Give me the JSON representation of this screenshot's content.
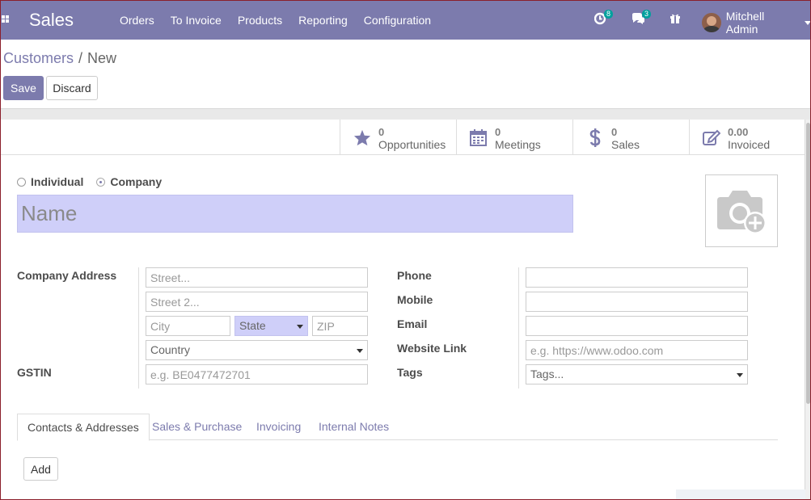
{
  "navbar": {
    "app_name": "Sales",
    "menu": [
      "Orders",
      "To Invoice",
      "Products",
      "Reporting",
      "Configuration"
    ],
    "activity_count": "8",
    "messages_count": "3",
    "user_name": "Mitchell Admin",
    "bg_color": "#7c7bad"
  },
  "breadcrumb": {
    "parent": "Customers",
    "separator": "/",
    "current": "New"
  },
  "actions": {
    "save": "Save",
    "discard": "Discard"
  },
  "smart_buttons": [
    {
      "icon": "star-icon",
      "value": "0",
      "label": "Opportunities"
    },
    {
      "icon": "calendar-icon",
      "value": "0",
      "label": "Meetings"
    },
    {
      "icon": "dollar-icon",
      "value": "0",
      "label": "Sales"
    },
    {
      "icon": "edit-icon",
      "value": "0.00",
      "label": "Invoiced"
    }
  ],
  "company_type": {
    "individual": "Individual",
    "company": "Company",
    "selected": "Company"
  },
  "name": {
    "placeholder": "Name"
  },
  "address": {
    "label": "Company Address",
    "street_placeholder": "Street...",
    "street2_placeholder": "Street 2...",
    "city_placeholder": "City",
    "state_placeholder": "State",
    "zip_placeholder": "ZIP",
    "country_placeholder": "Country"
  },
  "gstin": {
    "label": "GSTIN",
    "placeholder": "e.g. BE0477472701"
  },
  "contact": {
    "phone_label": "Phone",
    "mobile_label": "Mobile",
    "email_label": "Email",
    "website_label": "Website Link",
    "website_placeholder": "e.g. https://www.odoo.com",
    "tags_label": "Tags",
    "tags_placeholder": "Tags..."
  },
  "tabs": [
    "Contacts & Addresses",
    "Sales & Purchase",
    "Invoicing",
    "Internal Notes"
  ],
  "active_tab": "Contacts & Addresses",
  "add_button": "Add"
}
